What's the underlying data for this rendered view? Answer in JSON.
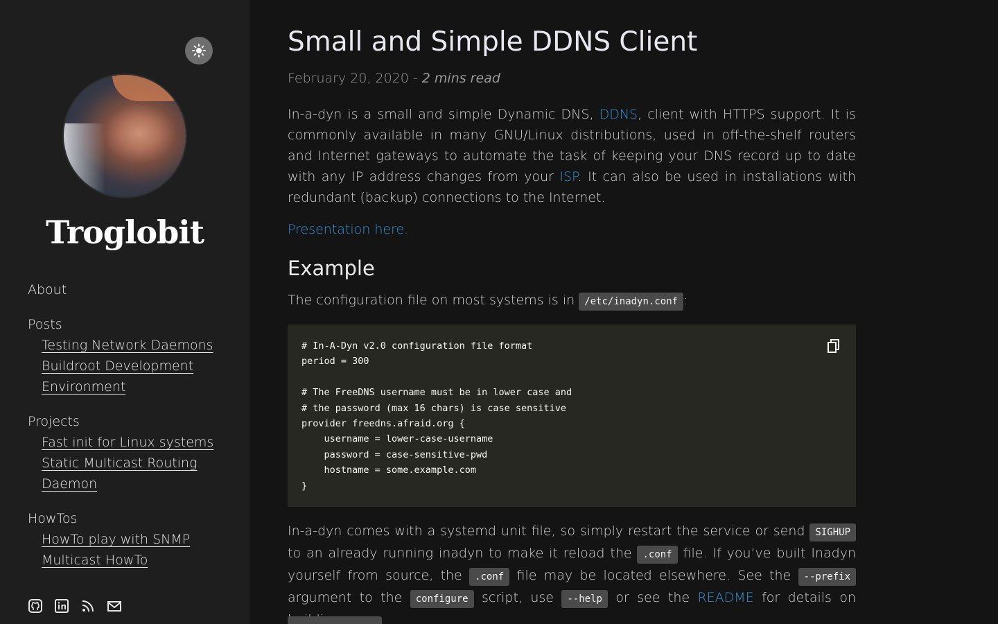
{
  "sidebar": {
    "site_title": "Troglobit",
    "nav": {
      "about": "About",
      "posts": "Posts",
      "posts_items": [
        "Testing Network Daemons",
        "Buildroot Development Environment"
      ],
      "projects": "Projects",
      "projects_items": [
        "Fast init for Linux systems",
        "Static Multicast Routing Daemon"
      ],
      "howtos": "HowTos",
      "howtos_items": [
        "HowTo play with SNMP",
        "Multicast HowTo"
      ]
    },
    "social_icons": [
      "github-icon",
      "linkedin-icon",
      "rss-icon",
      "email-icon"
    ]
  },
  "post": {
    "title": "Small and Simple DDNS Client",
    "date": "February 20, 2020",
    "separator": " - ",
    "read_time": "2 mins read",
    "p1": {
      "t1": "In-a-dyn is a small and simple Dynamic DNS, ",
      "link1": "DDNS",
      "t2": ", client with HTTPS support. It is commonly available in many GNU/Linux distributions, used in off-the-shelf routers and Internet gateways to automate the task of keeping your DNS record up to date with any IP address changes from your ",
      "link2": "ISP",
      "t3": ". It can also be used in installations with redundant (backup) connections to the Internet."
    },
    "presentation_link": "Presentation here.",
    "example_heading": "Example",
    "p2": {
      "t1": "The configuration file on most systems is in ",
      "code": "/etc/inadyn.conf",
      "t2": ":"
    },
    "code_block": "# In-A-Dyn v2.0 configuration file format\nperiod = 300\n\n# The FreeDNS username must be in lower case and\n# the password (max 16 chars) is case sensitive\nprovider freedns.afraid.org {\n    username = lower-case-username\n    password = case-sensitive-pwd\n    hostname = some.example.com\n}",
    "p3": {
      "t1": "In-a-dyn comes with a systemd unit file, so simply restart the service or send ",
      "c1": "SIGHUP",
      "t2": " to an already running inadyn to make it reload the ",
      "c2": ".conf",
      "t3": " file. If you’ve built Inadyn yourself from source, the ",
      "c3": ".conf",
      "t4": " file may be located elsewhere. See the ",
      "c4": "--prefix",
      "t5": " argument to the ",
      "c5": "configure",
      "t6": " script, use ",
      "c6": "--help",
      "t7": " or see the ",
      "link": "README",
      "t8": " for details on building."
    }
  },
  "colors": {
    "background": "#141414",
    "sidebar": "#1e1e1e",
    "link": "#3a8fd6",
    "code_bg": "#272822",
    "inline_code_bg": "#4a4a4a"
  }
}
